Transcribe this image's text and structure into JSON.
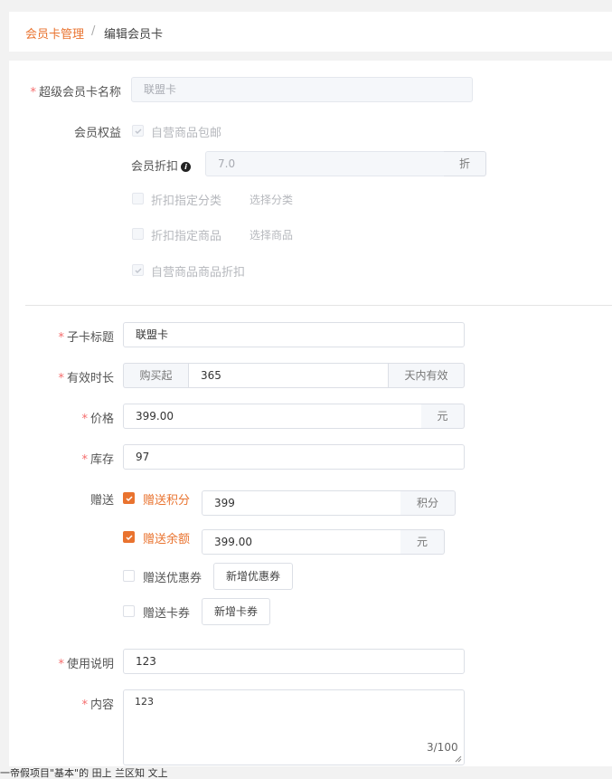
{
  "breadcrumb": {
    "parent": "会员卡管理",
    "sep": "/",
    "current": "编辑会员卡"
  },
  "super_card": {
    "label": "超级会员卡名称",
    "value": "联盟卡"
  },
  "benefits": {
    "label": "会员权益",
    "self_shipping": "自营商品包邮",
    "discount_label": "会员折扣",
    "discount_value": "7.0",
    "discount_unit": "折",
    "discount_category": "折扣指定分类",
    "choose_category": "选择分类",
    "discount_goods": "折扣指定商品",
    "choose_goods": "选择商品",
    "self_discount": "自营商品商品折扣"
  },
  "sub_title": {
    "label": "子卡标题",
    "value": "联盟卡"
  },
  "validity": {
    "label": "有效时长",
    "prefix": "购买起",
    "value": "365",
    "suffix": "天内有效"
  },
  "price": {
    "label": "价格",
    "value": "399.00",
    "unit": "元"
  },
  "stock": {
    "label": "库存",
    "value": "97"
  },
  "gift": {
    "label": "赠送",
    "points": {
      "label": "赠送积分",
      "value": "399",
      "unit": "积分",
      "checked": true
    },
    "balance": {
      "label": "赠送余额",
      "value": "399.00",
      "unit": "元",
      "checked": true
    },
    "coupon": {
      "label": "赠送优惠券",
      "button": "新增优惠券",
      "checked": false
    },
    "card_coupon": {
      "label": "赠送卡券",
      "button": "新增卡券",
      "checked": false
    }
  },
  "usage": {
    "label": "使用说明",
    "value": "123"
  },
  "content": {
    "label": "内容",
    "value": "123",
    "count": "3/100"
  },
  "footer_text": "一帝假项目\"基本\"的 田上 兰区知 文上",
  "colors": {
    "accent": "#e9732f",
    "required": "#f56c6c"
  }
}
